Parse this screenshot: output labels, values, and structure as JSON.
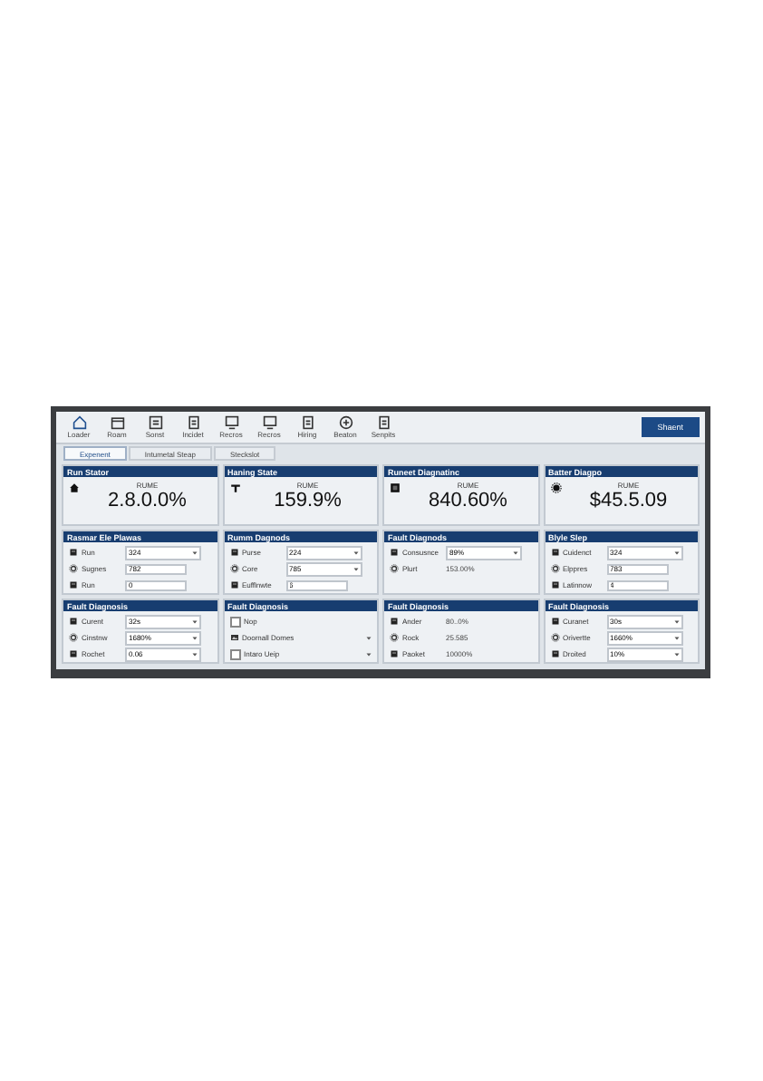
{
  "toolbar": {
    "buttons": [
      {
        "label": "Loader"
      },
      {
        "label": "Roam"
      },
      {
        "label": "Sonst"
      },
      {
        "label": "Incidet"
      },
      {
        "label": "Recros"
      },
      {
        "label": "Recros"
      },
      {
        "label": "Hiring"
      },
      {
        "label": "Beaton"
      },
      {
        "label": "Senpits"
      }
    ],
    "action": "Shaent"
  },
  "tabs": [
    {
      "label": "Expenent",
      "selected": true
    },
    {
      "label": "Intumetal Steap",
      "selected": false
    },
    {
      "label": "Steckslot",
      "selected": false
    }
  ],
  "stat_cards": [
    {
      "title": "Run Stator",
      "label": "RUME",
      "value": "2.8.0.0%"
    },
    {
      "title": "Haning State",
      "label": "RUME",
      "value": "159.9%"
    },
    {
      "title": "Runeet Diagnatinc",
      "label": "RUME",
      "value": "840.60%"
    },
    {
      "title": "Batter Diagpo",
      "label": "RUME",
      "value": "$45.5.09"
    }
  ],
  "panels": [
    {
      "title": "Rasmar Ele Plawas",
      "rows": [
        {
          "kind": "select",
          "label": "Run",
          "value": "324"
        },
        {
          "kind": "input",
          "label": "Sugnes",
          "value": "782"
        },
        {
          "kind": "input",
          "label": "Run",
          "value": "0"
        }
      ]
    },
    {
      "title": "Rumm Dagnods",
      "rows": [
        {
          "kind": "select",
          "label": "Purse",
          "value": "224"
        },
        {
          "kind": "select",
          "label": "Core",
          "value": "785"
        },
        {
          "kind": "input",
          "label": "Eufflnwte",
          "value": "6"
        }
      ]
    },
    {
      "title": "Fault Diagnods",
      "rows": [
        {
          "kind": "select",
          "label": "Consusnce",
          "value": "89%"
        },
        {
          "kind": "plain",
          "label": "Plurt",
          "value": "153.00%"
        }
      ]
    },
    {
      "title": "Blyle Slep",
      "rows": [
        {
          "kind": "select",
          "label": "Cuidenct",
          "value": "324"
        },
        {
          "kind": "input",
          "label": "Elppres",
          "value": "783"
        },
        {
          "kind": "input",
          "label": "Latinnow",
          "value": "4"
        }
      ]
    },
    {
      "title": "Fault Diagnosis",
      "rows": [
        {
          "kind": "select",
          "label": "Curent",
          "value": "32s"
        },
        {
          "kind": "select",
          "label": "Cinstnw",
          "value": "1680%"
        },
        {
          "kind": "select",
          "label": "Rochet",
          "value": "0.06"
        }
      ]
    },
    {
      "title": "Fault Diagnosis",
      "rows": [
        {
          "kind": "check",
          "label": "Nop",
          "checked": false
        },
        {
          "kind": "menu",
          "label": "Doornall Domes"
        },
        {
          "kind": "check-menu",
          "label": "Intaro Ueip",
          "checked": false
        }
      ]
    },
    {
      "title": "Fault Diagnosis",
      "rows": [
        {
          "kind": "plain",
          "label": "Ander",
          "value": "80..0%"
        },
        {
          "kind": "plain",
          "label": "Rock",
          "value": "25.585"
        },
        {
          "kind": "plain",
          "label": "Paoket",
          "value": "10000%"
        }
      ]
    },
    {
      "title": "Fault Diagnosis",
      "rows": [
        {
          "kind": "select",
          "label": "Curanet",
          "value": "30s"
        },
        {
          "kind": "select",
          "label": "Orivertte",
          "value": "1660%"
        },
        {
          "kind": "select",
          "label": "Droited",
          "value": "10%"
        }
      ]
    }
  ]
}
